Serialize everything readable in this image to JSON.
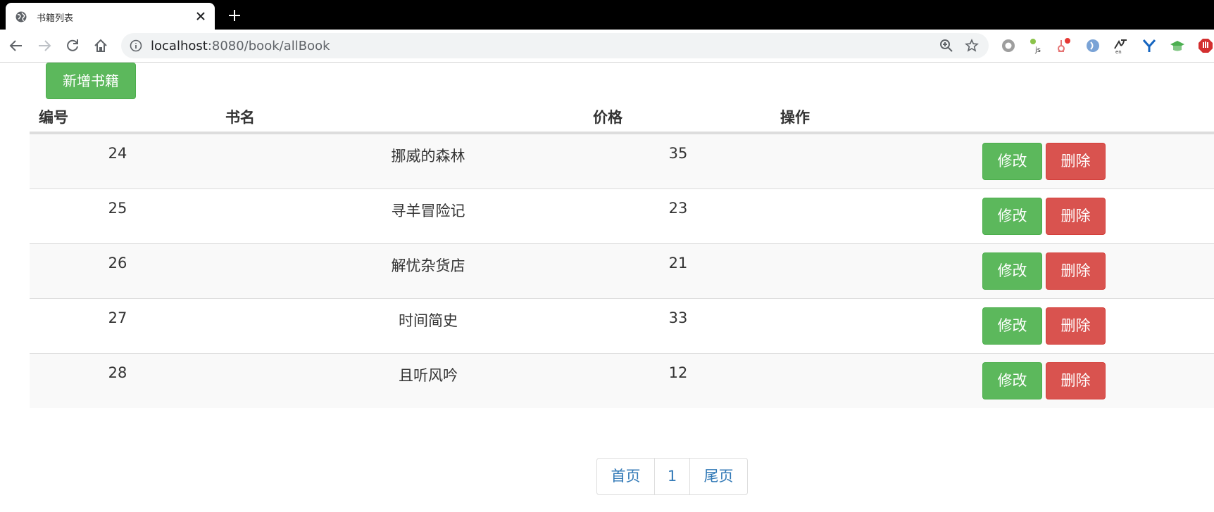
{
  "browser": {
    "tab_title": "书籍列表",
    "url_host": "localhost",
    "url_path": ":8080/book/allBook"
  },
  "page": {
    "add_button_label": "新增书籍",
    "table": {
      "headers": [
        "编号",
        "书名",
        "价格",
        "操作"
      ],
      "rows": [
        {
          "id": "24",
          "name": "挪威的森林",
          "price": "35"
        },
        {
          "id": "25",
          "name": "寻羊冒险记",
          "price": "23"
        },
        {
          "id": "26",
          "name": "解忧杂货店",
          "price": "21"
        },
        {
          "id": "27",
          "name": "时间简史",
          "price": "33"
        },
        {
          "id": "28",
          "name": "且听风吟",
          "price": "12"
        }
      ],
      "edit_label": "修改",
      "delete_label": "删除"
    },
    "pagination": {
      "first": "首页",
      "current": "1",
      "last": "尾页"
    }
  },
  "colors": {
    "success": "#5cb85c",
    "danger": "#d9534f",
    "link": "#337ab7"
  }
}
